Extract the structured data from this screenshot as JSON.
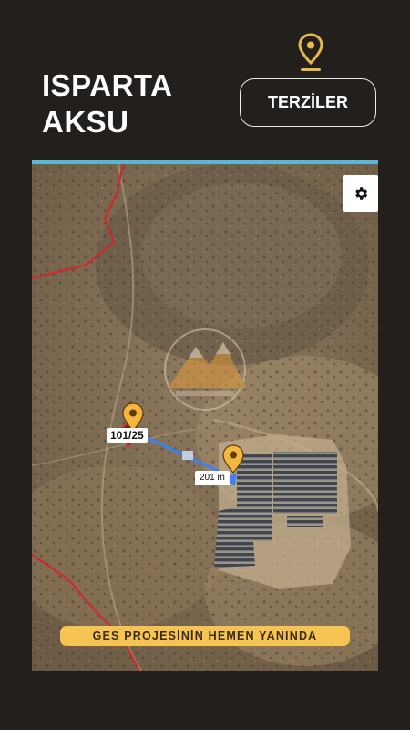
{
  "header": {
    "city": "ISPARTA",
    "district": "AKSU",
    "location_button_label": "TERZİLER",
    "pin_icon": "map-pin-icon",
    "accent_color": "#e8b84a"
  },
  "map": {
    "parcel_label": "101/25",
    "distance_label": "201 m",
    "caption": "GES PROJESİNİN HEMEN YANINDA",
    "settings_icon": "gear-icon",
    "frame_color": "#5bb5d6",
    "boundary_color": "#d8232a",
    "route_color": "#3b82f6",
    "marker_color": "#f4b63f"
  }
}
